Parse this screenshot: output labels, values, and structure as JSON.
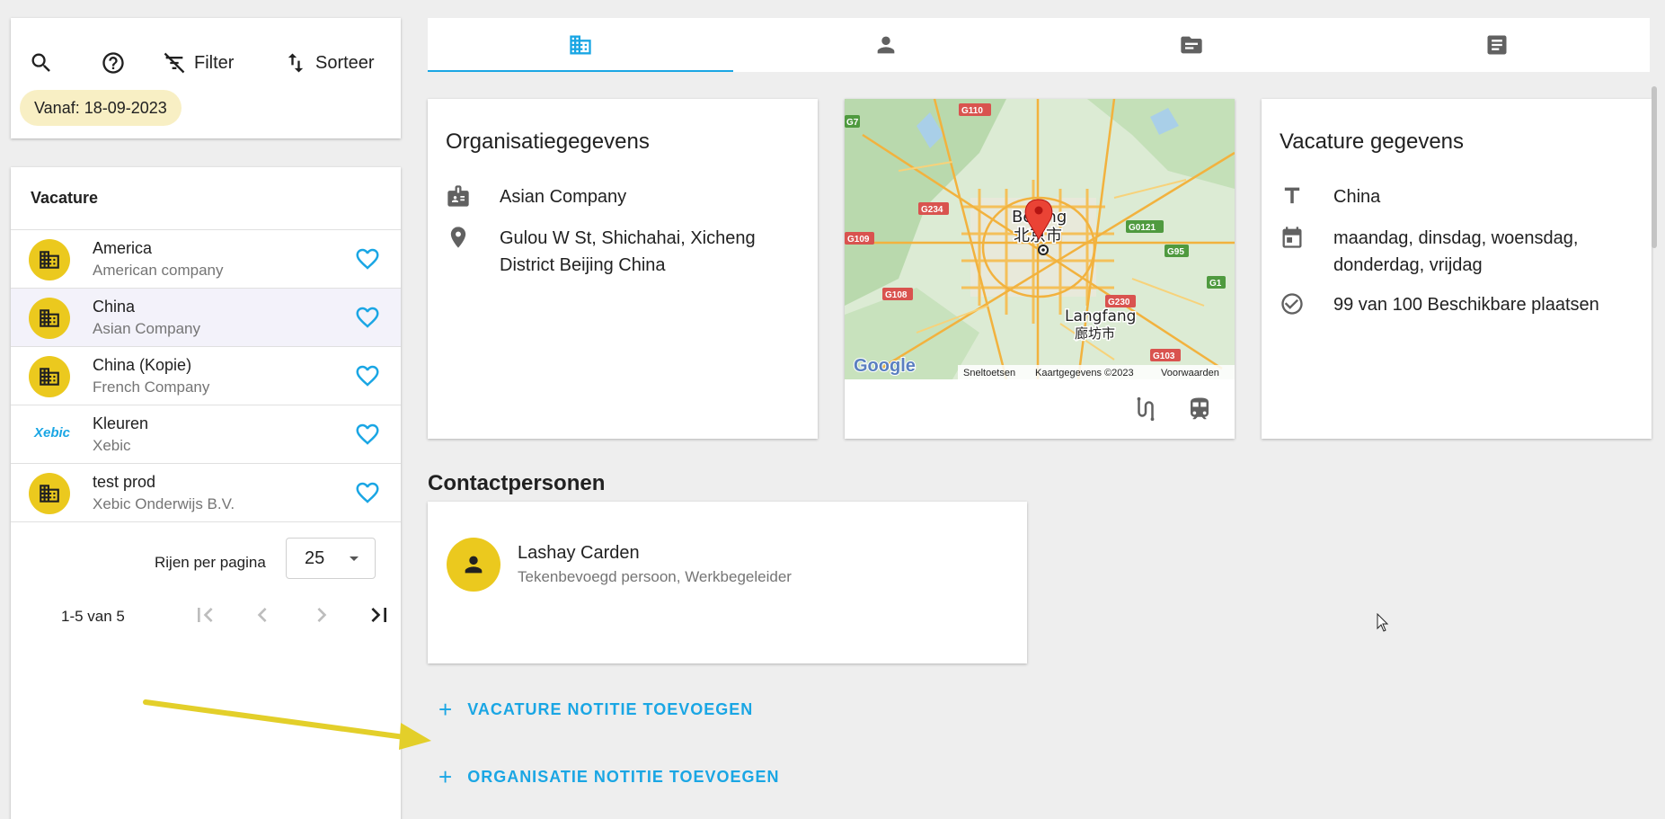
{
  "toolbar": {
    "filter_label": "Filter",
    "sort_label": "Sorteer",
    "chip_label": "Vanaf: 18-09-2023"
  },
  "list": {
    "header": "Vacature",
    "rows": [
      {
        "title": "America",
        "subtitle": "American company",
        "avatar": "building-icon"
      },
      {
        "title": "China",
        "subtitle": "Asian Company",
        "avatar": "building-icon",
        "selected": true
      },
      {
        "title": "China (Kopie)",
        "subtitle": "French Company",
        "avatar": "building-icon"
      },
      {
        "title": "Kleuren",
        "subtitle": "Xebic",
        "avatar": "logo",
        "logo_text": "Xebic"
      },
      {
        "title": "test prod",
        "subtitle": "Xebic Onderwijs B.V.",
        "avatar": "building-icon"
      }
    ],
    "pager": {
      "rows_per_page_label": "Rijen per pagina",
      "rows_per_page_value": "25",
      "range": "1-5 van 5"
    }
  },
  "tabs": [
    {
      "icon": "building-icon",
      "active": true
    },
    {
      "icon": "person-icon",
      "active": false
    },
    {
      "icon": "folder-icon",
      "active": false
    },
    {
      "icon": "notes-icon",
      "active": false
    }
  ],
  "org": {
    "title": "Organisatiegegevens",
    "company": "Asian Company",
    "address_line1": "Gulou W St, Shichahai, Xicheng",
    "address_line2": "District Beijing China"
  },
  "map": {
    "city_label_en": "Beijing",
    "city_label_cn": "北京市",
    "city2_label_en": "Langfang",
    "city2_label_cn": "廊坊市",
    "road_labels": [
      "G110",
      "G7",
      "G234",
      "G109",
      "G108",
      "G0121",
      "G95",
      "G1",
      "G230",
      "G103"
    ],
    "attribution_shortcuts": "Sneltoetsen",
    "attribution_data": "Kaartgegevens ©2023",
    "attribution_terms": "Voorwaarden",
    "google_logo": "Google"
  },
  "vacancy": {
    "title": "Vacature gegevens",
    "name": "China",
    "days_line1": "maandag, dinsdag, woensdag,",
    "days_line2": "donderdag, vrijdag",
    "availability": "99 van 100 Beschikbare plaatsen"
  },
  "contacts": {
    "heading": "Contactpersonen",
    "name": "Lashay Carden",
    "role": "Tekenbevoegd persoon, Werkbegeleider"
  },
  "actions": {
    "add_vacancy_note": "VACATURE NOTITIE TOEVOEGEN",
    "add_org_note": "ORGANISATIE NOTITIE TOEVOEGEN"
  },
  "colors": {
    "accent": "#1aa6e4",
    "avatar_yellow": "#ebc91e",
    "chip_bg": "#f8efc4",
    "annotation_arrow": "#e3cf2a"
  }
}
